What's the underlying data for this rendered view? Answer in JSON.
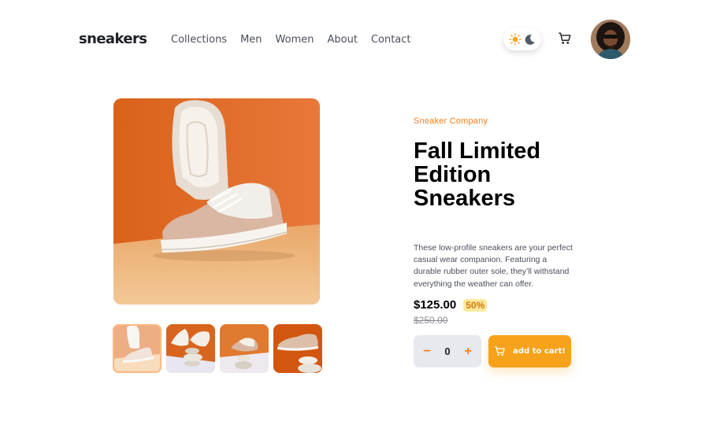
{
  "header": {
    "logo": "sneakers",
    "nav": [
      "Collections",
      "Men",
      "Women",
      "About",
      "Contact"
    ]
  },
  "product": {
    "company": "Sneaker Company",
    "title": "Fall Limited Edition Sneakers",
    "description": "These low-profile sneakers are your perfect casual wear companion. Featuring a durable rubber outer sole, they’ll withstand everything the weather can offer.",
    "price": "$125.00",
    "discount": "50%",
    "old_price": "$250.00"
  },
  "cart": {
    "decrement": "−",
    "quantity": "0",
    "increment": "+",
    "add_label": "add to cart!"
  },
  "icons": {
    "theme": [
      "sun-icon",
      "moon-icon"
    ],
    "cart": "cart-icon",
    "user": "avatar"
  },
  "colors": {
    "accent": "#ff7e1b",
    "button": "#f7a21b",
    "discount_bg": "#ffe99c",
    "text_dark": "#1d2026"
  },
  "gallery": {
    "active_thumbnail": 1,
    "thumbnail_count": 4
  }
}
